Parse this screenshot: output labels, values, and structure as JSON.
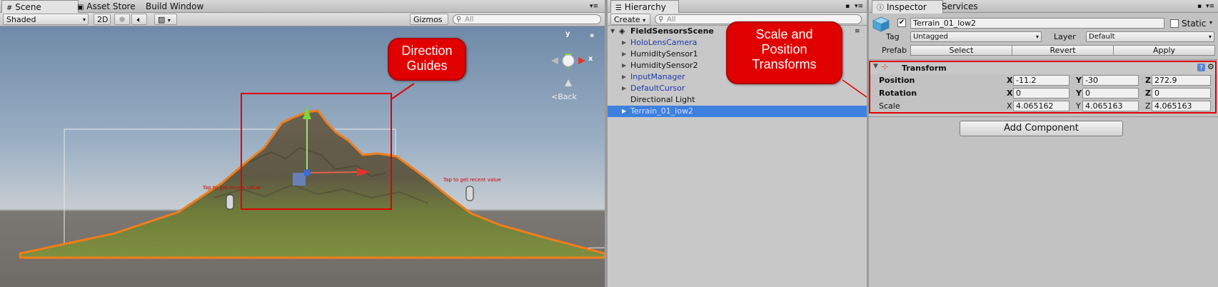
{
  "scene_panel": {
    "tabs": [
      {
        "label": "Scene",
        "icon": "grid-icon"
      },
      {
        "label": "Asset Store",
        "icon": "store-icon"
      },
      {
        "label": "Build Window"
      }
    ],
    "toolbar": {
      "shading_mode": "Shaded",
      "toggle_2d": "2D",
      "gizmos_label": "Gizmos",
      "search_placeholder": "All"
    },
    "gizmo_back_label": "Back",
    "gizmo_axes": {
      "y": "y",
      "x": "x"
    },
    "scene_labels": {
      "right": "Tap to get recent value",
      "left": "Tap to get recent value"
    }
  },
  "callouts": {
    "direction_guides": [
      "Direction",
      "Guides"
    ],
    "transforms": [
      "Scale and",
      "Position",
      "Transforms"
    ]
  },
  "hierarchy": {
    "tab_label": "Hierarchy",
    "create_label": "Create",
    "search_placeholder": "All",
    "scene_name": "FieldSensorsScene",
    "items": [
      {
        "label": "HoloLensCamera",
        "prefab": true,
        "expandable": true
      },
      {
        "label": "HumiditySensor1",
        "prefab": false,
        "expandable": true
      },
      {
        "label": "HumiditySensor2",
        "prefab": false,
        "expandable": true
      },
      {
        "label": "InputManager",
        "prefab": true,
        "expandable": true
      },
      {
        "label": "DefaultCursor",
        "prefab": true,
        "expandable": true
      },
      {
        "label": "Directional Light",
        "prefab": false,
        "expandable": false
      },
      {
        "label": "Terrain_01_low2",
        "prefab": true,
        "expandable": true,
        "selected": true
      }
    ]
  },
  "inspector": {
    "tabs": [
      {
        "label": "Inspector",
        "icon": "info-icon"
      },
      {
        "label": "Services"
      }
    ],
    "object_name": "Terrain_01_low2",
    "static_label": "Static",
    "tag_label": "Tag",
    "tag_value": "Untagged",
    "layer_label": "Layer",
    "layer_value": "Default",
    "prefab_label": "Prefab",
    "prefab_buttons": {
      "select": "Select",
      "revert": "Revert",
      "apply": "Apply"
    },
    "transform": {
      "title": "Transform",
      "rows": [
        {
          "label": "Position",
          "x": "-11.2",
          "y": "-30",
          "z": "272.9"
        },
        {
          "label": "Rotation",
          "x": "0",
          "y": "0",
          "z": "0"
        },
        {
          "label": "Scale",
          "x": "4.065162",
          "y": "4.065163",
          "z": "4.065163"
        }
      ],
      "axis_labels": {
        "x": "X",
        "y": "Y",
        "z": "Z"
      }
    },
    "add_component_label": "Add Component"
  },
  "colors": {
    "callout_red": "#e00000",
    "selection_blue": "#3d80df",
    "terrain_outline": "#f07d1a",
    "prefab_text_blue": "#1c3aa6"
  }
}
